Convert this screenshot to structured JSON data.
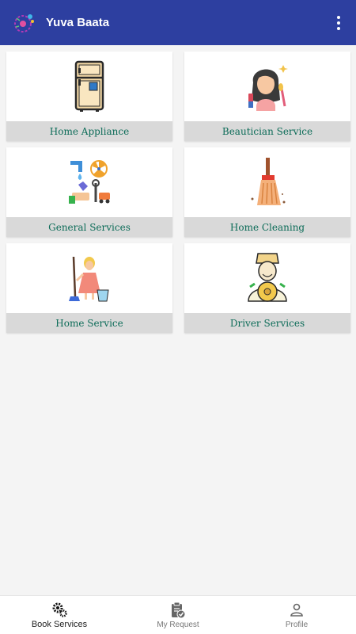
{
  "app": {
    "title": "Yuva Baata"
  },
  "services": [
    {
      "label": "Home Appliance",
      "icon": "refrigerator-icon"
    },
    {
      "label": "Beautician Service",
      "icon": "beautician-icon"
    },
    {
      "label": "General Services",
      "icon": "general-services-icon"
    },
    {
      "label": "Home Cleaning",
      "icon": "broom-icon"
    },
    {
      "label": "Home Service",
      "icon": "maid-mop-icon"
    },
    {
      "label": "Driver Services",
      "icon": "driver-icon"
    }
  ],
  "bottom_nav": {
    "items": [
      {
        "label": "Book Services",
        "icon": "gears-icon",
        "active": true
      },
      {
        "label": "My Request",
        "icon": "clipboard-check-icon",
        "active": false
      },
      {
        "label": "Profile",
        "icon": "person-icon",
        "active": false
      }
    ]
  },
  "colors": {
    "appbar": "#2d3fa0",
    "label_text": "#0b6b57",
    "label_bg": "#d9d9d9"
  }
}
